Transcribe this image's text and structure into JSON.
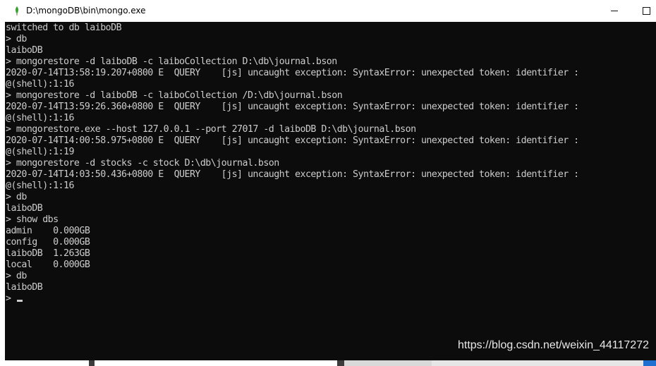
{
  "window": {
    "title": "D:\\mongoDB\\bin\\mongo.exe",
    "icon": "mongodb-leaf-icon",
    "minimize_glyph": "minimize-icon",
    "maximize_glyph": "maximize-icon"
  },
  "console": {
    "lines": [
      "switched to db laiboDB",
      "> db",
      "laiboDB",
      "> mongorestore -d laiboDB -c laiboCollection D:\\db\\journal.bson",
      "2020-07-14T13:58:19.207+0800 E  QUERY    [js] uncaught exception: SyntaxError: unexpected token: identifier :",
      "@(shell):1:16",
      "> mongorestore -d laiboDB -c laiboCollection /D:\\db\\journal.bson",
      "2020-07-14T13:59:26.360+0800 E  QUERY    [js] uncaught exception: SyntaxError: unexpected token: identifier :",
      "@(shell):1:16",
      "> mongorestore.exe --host 127.0.0.1 --port 27017 -d laiboDB D:\\db\\journal.bson",
      "2020-07-14T14:00:58.975+0800 E  QUERY    [js] uncaught exception: SyntaxError: unexpected token: identifier :",
      "@(shell):1:19",
      "> mongorestore -d stocks -c stock D:\\db\\journal.bson",
      "2020-07-14T14:03:50.436+0800 E  QUERY    [js] uncaught exception: SyntaxError: unexpected token: identifier :",
      "@(shell):1:16",
      "> db",
      "laiboDB",
      "> show dbs",
      "admin    0.000GB",
      "config   0.000GB",
      "laiboDB  1.263GB",
      "local    0.000GB",
      "> db",
      "laiboDB"
    ],
    "prompt": "> "
  },
  "watermark": "https://blog.csdn.net/weixin_44117272",
  "colors": {
    "console_bg": "#0c0c0c",
    "console_fg": "#cccccc",
    "titlebar_bg": "#ffffff",
    "icon_green": "#3fa037"
  }
}
